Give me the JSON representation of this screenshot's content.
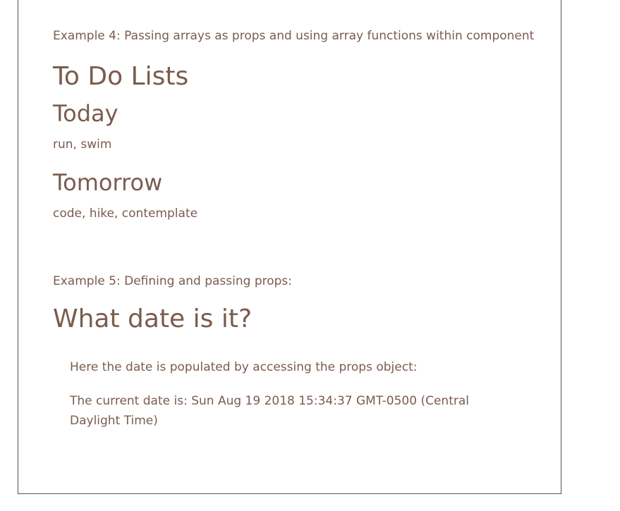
{
  "example4": {
    "caption": "Example 4: Passing arrays as props and using array functions within component",
    "title": "To Do Lists",
    "lists": [
      {
        "heading": "Today",
        "items": "run, swim"
      },
      {
        "heading": "Tomorrow",
        "items": "code, hike, contemplate"
      }
    ]
  },
  "example5": {
    "caption": "Example 5: Defining and passing props:",
    "title": "What date is it?",
    "description": "Here the date is populated by accessing the props object:",
    "current_date": "The current date is: Sun Aug 19 2018 15:34:37 GMT-0500 (Central Daylight Time)"
  }
}
